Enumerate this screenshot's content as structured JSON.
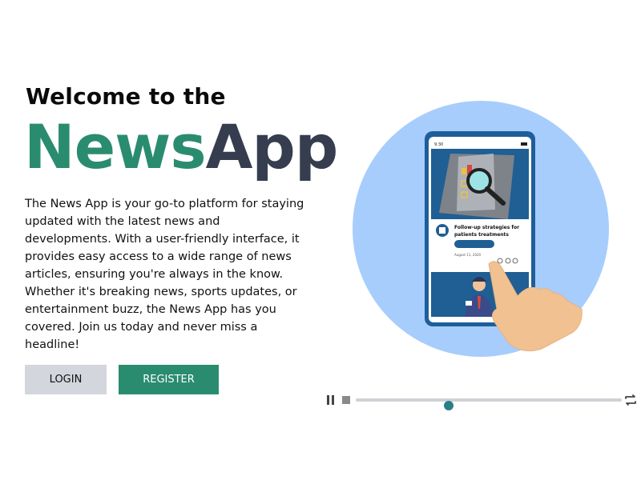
{
  "hero": {
    "welcome": "Welcome to the",
    "brand_part1": "News",
    "brand_part2": "App",
    "description": "The News App is your go-to platform for staying updated with the latest news and developments. With a user-friendly interface, it provides easy access to a wide range of news articles, ensuring you're always in the know. Whether it's breaking news, sports updates, or entertainment buzz, the News App has you covered. Join us today and never miss a headline!"
  },
  "buttons": {
    "login": "LOGIN",
    "register": "REGISTER"
  },
  "phone_mock": {
    "time": "9:30",
    "article_title_line1": "Follow-up strategies for",
    "article_title_line2": "patients treatments",
    "article_date": "August 11, 2020"
  },
  "player": {
    "progress": 0.35,
    "icons": [
      "pause-icon",
      "stop-icon",
      "loop-icon"
    ]
  },
  "colors": {
    "brand_green": "#2a8c6f",
    "brand_dark": "#353d4f",
    "circle_bg": "#a7cdfc",
    "phone_blue": "#1e5e9a"
  }
}
